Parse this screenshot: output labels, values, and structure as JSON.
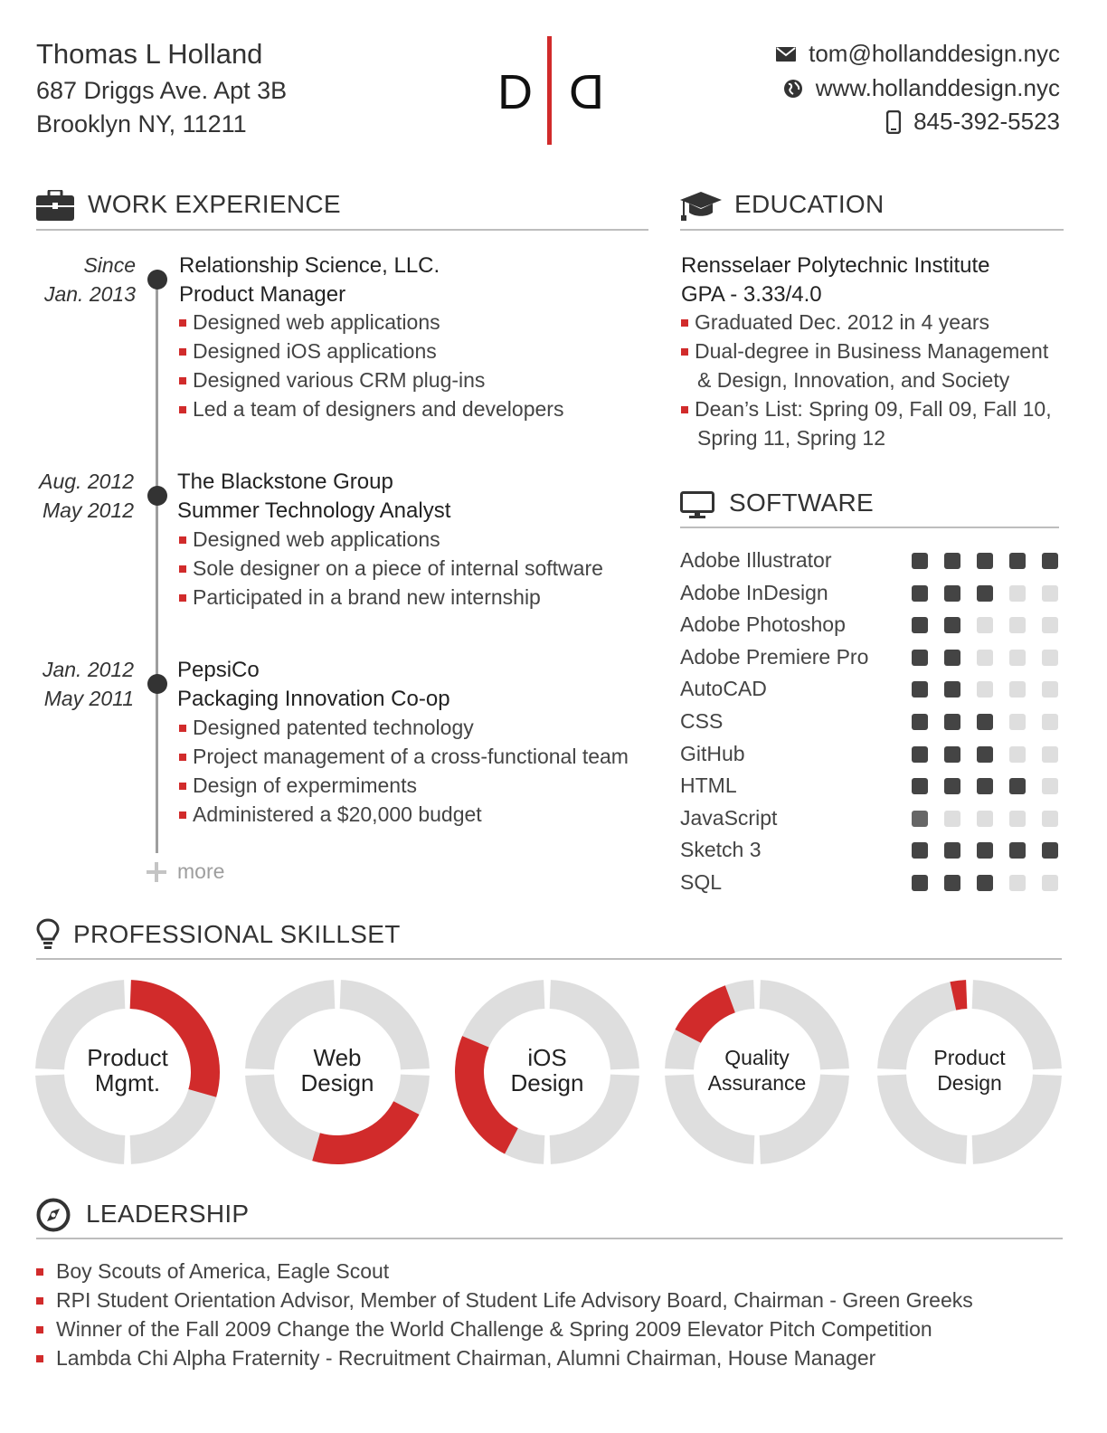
{
  "header": {
    "name": "Thomas L Holland",
    "address1": "687 Driggs Ave. Apt 3B",
    "address2": "Brooklyn NY, 11211",
    "logo_left": "D",
    "logo_right": "D",
    "email": "tom@hollanddesign.nyc",
    "website": "www.hollanddesign.nyc",
    "phone": "845-392-5523",
    "icons": [
      "envelope-icon",
      "globe-icon",
      "phone-icon"
    ]
  },
  "colors": {
    "accent": "#d12b2b",
    "dark": "#333333",
    "light": "#dedede",
    "rule": "#bdbdbd"
  },
  "work": {
    "title": "WORK EXPERIENCE",
    "jobs": [
      {
        "date1": "Since",
        "date2": "Jan. 2013",
        "company": "Relationship Science, LLC.",
        "role": "Product Manager",
        "bullets": [
          "Designed web applications",
          "Designed iOS applications",
          "Designed various CRM plug-ins",
          "Led a team of designers and developers"
        ]
      },
      {
        "date1": "Aug. 2012",
        "date2": "May 2012",
        "company": "The Blackstone Group",
        "role": "Summer Technology Analyst",
        "bullets": [
          "Designed web applications",
          "Sole designer on a piece of internal software",
          "Participated in a brand new internship"
        ]
      },
      {
        "date1": "Jan. 2012",
        "date2": "May 2011",
        "company": "PepsiCo",
        "role": "Packaging Innovation Co-op",
        "bullets": [
          "Designed patented technology",
          "Project management of a cross-functional team",
          "Design of expermiments",
          "Administered a $20,000 budget"
        ]
      }
    ],
    "more": "more"
  },
  "education": {
    "title": "EDUCATION",
    "school": "Rensselaer Polytechnic Institute",
    "gpa": "GPA - 3.33/4.0",
    "b1": "Graduated Dec. 2012 in 4 years",
    "b2a": "Dual-degree in Business Management",
    "b2b": "& Design, Innovation, and Society",
    "b3a": "Dean’s List: Spring 09, Fall 09, Fall 10,",
    "b3b": "Spring 11, Spring 12"
  },
  "software": {
    "title": "SOFTWARE",
    "items": [
      {
        "name": "Adobe Illustrator",
        "level": 5
      },
      {
        "name": "Adobe InDesign",
        "level": 3
      },
      {
        "name": "Adobe Photoshop",
        "level": 2
      },
      {
        "name": "Adobe Premiere Pro",
        "level": 2
      },
      {
        "name": "AutoCAD",
        "level": 2
      },
      {
        "name": "CSS",
        "level": 3
      },
      {
        "name": "GitHub",
        "level": 3
      },
      {
        "name": "HTML",
        "level": 4
      },
      {
        "name": "JavaScript",
        "level": 1
      },
      {
        "name": "Sketch 3",
        "level": 5
      },
      {
        "name": "SQL",
        "level": 3
      }
    ],
    "max_level": 5
  },
  "skills": {
    "title": "PROFESSIONAL SKILLSET",
    "items": [
      {
        "line1": "Product",
        "line2": "Mgmt.",
        "fill_start": 0.0,
        "fill_end": 0.3
      },
      {
        "line1": "Web",
        "line2": "Design",
        "fill_start": 0.32,
        "fill_end": 0.55
      },
      {
        "line1": "iOS",
        "line2": "Design",
        "fill_start": 0.57,
        "fill_end": 0.82
      },
      {
        "line1": "Quality",
        "line2": "Assurance",
        "fill_start": 0.82,
        "fill_end": 0.95
      },
      {
        "line1": "Product",
        "line2": "Design",
        "fill_start": 0.96,
        "fill_end": 1.0
      }
    ]
  },
  "leadership": {
    "title": "LEADERSHIP",
    "items": [
      "Boy Scouts of America, Eagle Scout",
      "RPI Student Orientation Advisor, Member of Student Life Advisory Board, Chairman - Green Greeks",
      "Winner of the Fall 2009 Change the World Challenge & Spring 2009 Elevator Pitch Competition",
      "Lambda Chi Alpha Fraternity - Recruitment Chairman, Alumni Chairman, House Manager"
    ]
  }
}
